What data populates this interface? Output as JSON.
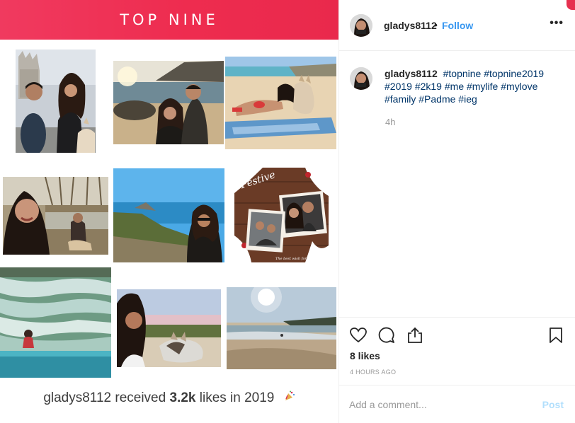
{
  "banner": {
    "title": "TOP NINE"
  },
  "summary": {
    "user": "gladys8112",
    "received": "received",
    "likes": "3.2k",
    "likes_in": "likes in",
    "year": "2019"
  },
  "post": {
    "username": "gladys8112",
    "separator": "•",
    "follow_label": "Follow",
    "more_label": "•••"
  },
  "caption": {
    "username": "gladys8112",
    "hashtags": [
      "#topnine",
      "#topnine2019",
      "#2019",
      "#2k19",
      "#me",
      "#mylife",
      "#mylove",
      "#family",
      "#Padme",
      "#ieg"
    ],
    "age": "4h"
  },
  "stats": {
    "likes": "8 likes",
    "time": "4 HOURS AGO"
  },
  "comment": {
    "placeholder": "Add a comment...",
    "post_label": "Post"
  },
  "icons": [
    "heart-icon",
    "comment-icon",
    "share-icon",
    "bookmark-icon",
    "party-popper-icon",
    "more-icon"
  ],
  "colors": {
    "banner": "#ee2c4f",
    "link": "#3897f0",
    "hashtag": "#003569",
    "post_disabled": "#b2dffc"
  },
  "photos": {
    "festive_text": "Festive",
    "festive_sub": "The best wish for you..."
  }
}
